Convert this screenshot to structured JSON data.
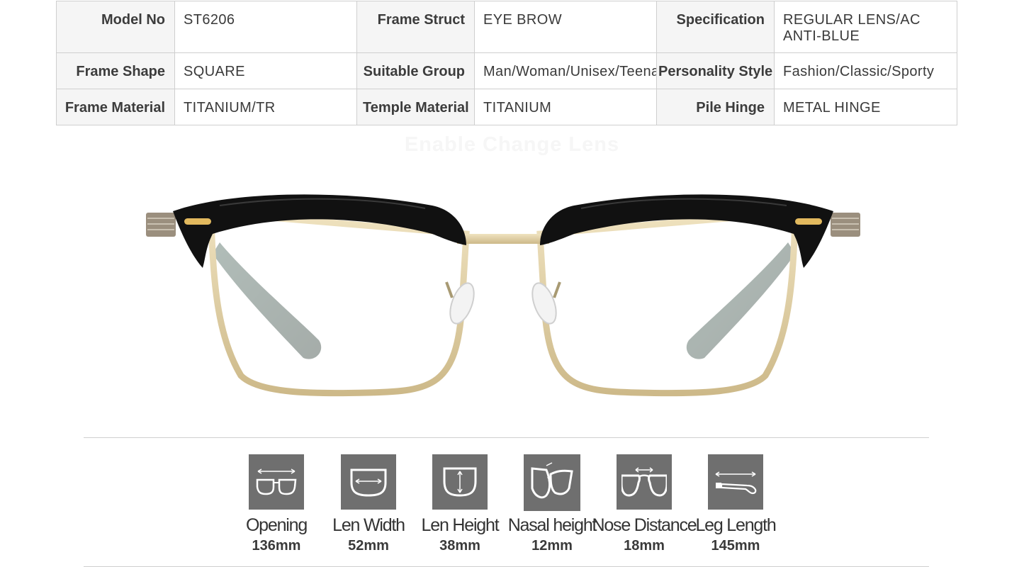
{
  "specs": [
    [
      {
        "label": "Model No",
        "value": "ST6206"
      },
      {
        "label": "Frame Struct",
        "value": "EYE BROW"
      },
      {
        "label": "Specification",
        "value": "REGULAR LENS/AC ANTI-BLUE"
      }
    ],
    [
      {
        "label": "Frame Shape",
        "value": "SQUARE"
      },
      {
        "label": "Suitable Group",
        "value": "Man/Woman/Unisex/Teenager"
      },
      {
        "label": "Personality Style",
        "value": "Fashion/Classic/Sporty"
      }
    ],
    [
      {
        "label": "Frame Material",
        "value": "TITANIUM/TR"
      },
      {
        "label": "Temple Material",
        "value": "TITANIUM"
      },
      {
        "label": "Pile Hinge",
        "value": "METAL HINGE"
      }
    ]
  ],
  "faint_caption": "Enable Change Lens",
  "measurements": [
    {
      "name": "Opening",
      "value": "136mm",
      "icon": "opening-icon"
    },
    {
      "name": "Len Width",
      "value": "52mm",
      "icon": "len-width-icon"
    },
    {
      "name": "Len Height",
      "value": "38mm",
      "icon": "len-height-icon"
    },
    {
      "name": "Nasal height",
      "value": "12mm",
      "icon": "nasal-height-icon"
    },
    {
      "name": "Nose Distance",
      "value": "18mm",
      "icon": "nose-distance-icon"
    },
    {
      "name": "Leg Length",
      "value": "145mm",
      "icon": "leg-length-icon"
    }
  ],
  "colors": {
    "frame_top": "#111111",
    "frame_metal": "#d9c89e",
    "temple_tip": "#2f4a40",
    "icon_bg": "#6f6f6f"
  }
}
